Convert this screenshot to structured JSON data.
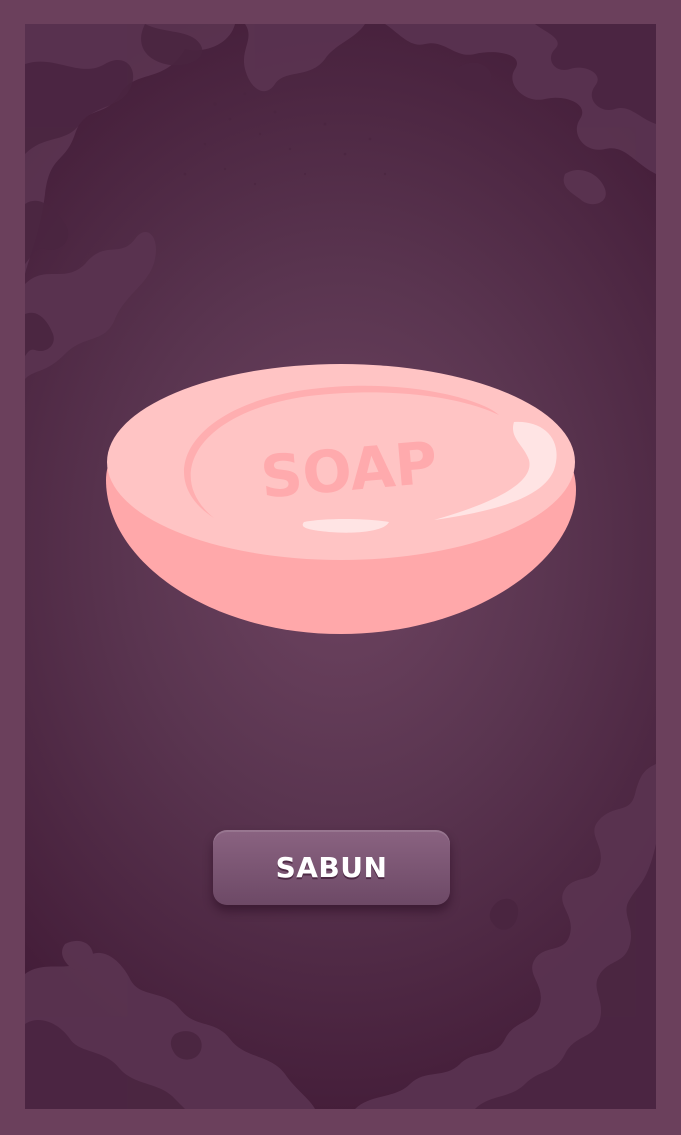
{
  "card": {
    "image_icon": "soap-bar-icon",
    "image_text": "SOAP",
    "label": "SABUN"
  },
  "colors": {
    "frame": "#6b405c",
    "background": "#5a3550",
    "soap_top": "#ffc4c4",
    "soap_side": "#ffa8aa",
    "button": "#7d5875"
  }
}
